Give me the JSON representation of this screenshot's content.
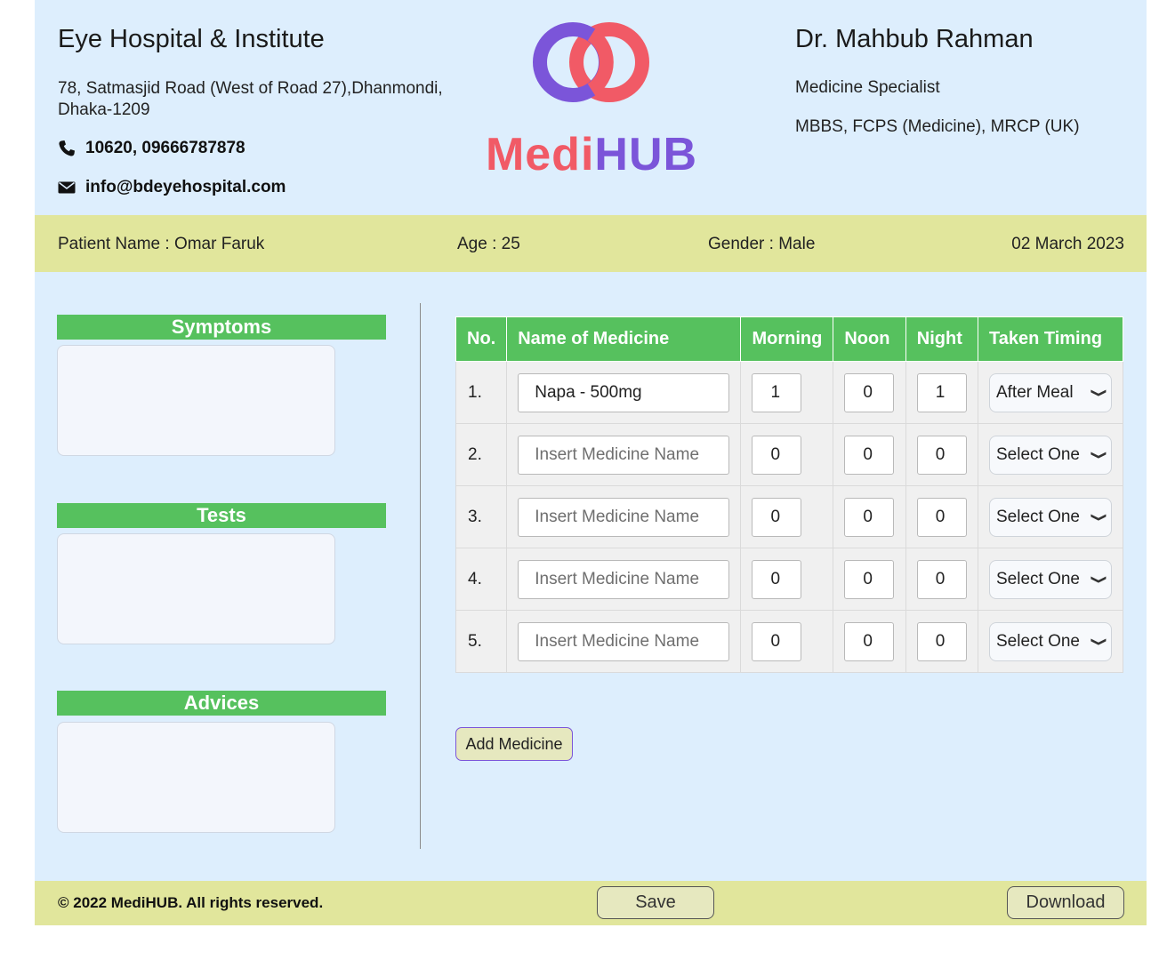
{
  "hospital": {
    "name": "Eye Hospital & Institute",
    "address": "78, Satmasjid Road (West of Road 27),Dhanmondi, Dhaka-1209",
    "phone": "10620, 09666787878",
    "email": "info@bdeyehospital.com"
  },
  "logo": {
    "text_part1": "Medi",
    "text_part2": "HUB",
    "colors": {
      "coral": "#f15a66",
      "purple": "#7b55d9"
    }
  },
  "doctor": {
    "name": "Dr. Mahbub Rahman",
    "specialty": "Medicine Specialist",
    "degrees": "MBBS, FCPS (Medicine), MRCP (UK)"
  },
  "patient": {
    "name": "Patient Name : Omar Faruk",
    "age": "Age : 25",
    "gender": "Gender : Male",
    "date": "02 March 2023"
  },
  "sections": {
    "symptoms": "Symptoms",
    "tests": "Tests",
    "advices": "Advices"
  },
  "table": {
    "headers": [
      "No.",
      "Name of Medicine",
      "Morning",
      "Noon",
      "Night",
      "Taken Timing"
    ],
    "rows": [
      {
        "no": "1.",
        "name": "Napa - 500mg",
        "placeholder": "Insert Medicine Name",
        "morning": "1",
        "noon": "0",
        "night": "1",
        "timing": "After Meal"
      },
      {
        "no": "2.",
        "name": "",
        "placeholder": "Insert Medicine Name",
        "morning": "0",
        "noon": "0",
        "night": "0",
        "timing": "Select One"
      },
      {
        "no": "3.",
        "name": "",
        "placeholder": "Insert Medicine Name",
        "morning": "0",
        "noon": "0",
        "night": "0",
        "timing": "Select One"
      },
      {
        "no": "4.",
        "name": "",
        "placeholder": "Insert Medicine Name",
        "morning": "0",
        "noon": "0",
        "night": "0",
        "timing": "Select One"
      },
      {
        "no": "5.",
        "name": "",
        "placeholder": "Insert Medicine Name",
        "morning": "0",
        "noon": "0",
        "night": "0",
        "timing": "Select One"
      }
    ]
  },
  "actions": {
    "add_medicine": "Add Medicine",
    "save": "Save",
    "download": "Download"
  },
  "footer": {
    "copyright": "© 2022 MediHUB. All rights reserved."
  },
  "colors": {
    "page_bg": "#ddeefd",
    "bar_bg": "#e1e69c",
    "header_green": "#56c15e"
  }
}
